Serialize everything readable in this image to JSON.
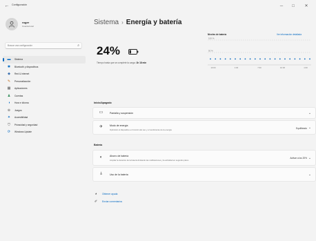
{
  "window": {
    "title": "Configuración",
    "back_glyph": "←",
    "min_glyph": "─",
    "max_glyph": "□",
    "close_glyph": "✕"
  },
  "user": {
    "name": "roger",
    "account_type": "Cuenta local"
  },
  "search": {
    "placeholder": "Buscar una configuración",
    "icon": "search-icon"
  },
  "nav": {
    "items": [
      {
        "label": "Sistema",
        "icon": "monitor-icon",
        "glyph": "▬",
        "color": "#0067c0",
        "active": true
      },
      {
        "label": "Bluetooth y dispositivos",
        "icon": "bluetooth-icon",
        "glyph": "✱",
        "color": "#0067c0",
        "active": false
      },
      {
        "label": "Red & Internet",
        "icon": "network-icon",
        "glyph": "◆",
        "color": "#3a6fb0",
        "active": false
      },
      {
        "label": "Personalización",
        "icon": "brush-icon",
        "glyph": "✎",
        "color": "#c06a1a",
        "active": false
      },
      {
        "label": "Aplicaciones",
        "icon": "apps-icon",
        "glyph": "▦",
        "color": "#555555",
        "active": false
      },
      {
        "label": "Cuentas",
        "icon": "account-icon",
        "glyph": "♟",
        "color": "#2e8b57",
        "active": false
      },
      {
        "label": "Hora e idioma",
        "icon": "clock-globe-icon",
        "glyph": "◑",
        "color": "#0067c0",
        "active": false
      },
      {
        "label": "Juegos",
        "icon": "gamepad-icon",
        "glyph": "⊕",
        "color": "#666666",
        "active": false
      },
      {
        "label": "Accesibilidad",
        "icon": "accessibility-icon",
        "glyph": "✦",
        "color": "#0067c0",
        "active": false
      },
      {
        "label": "Privacidad y seguridad",
        "icon": "shield-icon",
        "glyph": "⛉",
        "color": "#555555",
        "active": false
      },
      {
        "label": "Windows Update",
        "icon": "update-icon",
        "glyph": "⟳",
        "color": "#0067c0",
        "active": false
      }
    ]
  },
  "breadcrumb": {
    "root": "Sistema",
    "separator": "›",
    "current": "Energía y batería"
  },
  "battery": {
    "percent_text": "24%",
    "percent": 24,
    "time_prefix": "Tiempo hasta que se complete la carga:",
    "time_value": "1h 18 min"
  },
  "chart": {
    "title": "Niveles de batería",
    "link": "Ver información detallada"
  },
  "chart_data": {
    "type": "line",
    "title": "Niveles de batería",
    "y_tick_labels": [
      "100 %",
      "50 %"
    ],
    "x_tick_labels": [
      "10:00",
      "1:00",
      "7:00",
      "10:00",
      "1:00"
    ],
    "points_percent": [
      24,
      24,
      24,
      24,
      24,
      24,
      24,
      24,
      24,
      24,
      24,
      24,
      24,
      24,
      24,
      24,
      24,
      24,
      24,
      24,
      24
    ],
    "ylim": [
      0,
      100
    ],
    "grid": true
  },
  "power_section": {
    "title": "Inicio/Apagado",
    "screen_sleep": {
      "label": "Pantalla y suspensión",
      "icon": "screen-sleep-icon"
    },
    "power_mode": {
      "label": "Modo de energía",
      "description": "Optimizar el dispositivo en función del uso y el rendimiento de la energía",
      "value": "Equilibrado",
      "icon": "power-mode-icon"
    }
  },
  "battery_section": {
    "title": "Batería",
    "saver": {
      "label": "Ahorro de batería",
      "description": "Ampliar la duración de la batería limitando las notificaciones y la actividad en segundo plano",
      "value": "Activar a los 20%",
      "icon": "battery-saver-icon"
    },
    "usage": {
      "label": "Uso de la batería",
      "icon": "battery-usage-icon"
    }
  },
  "help": {
    "get_help": "Obtener ayuda",
    "feedback": "Enviar comentarios"
  },
  "colors": {
    "accent": "#0067c0",
    "window_bg": "#f3f3f3",
    "card_bg": "#fbfbfb"
  }
}
